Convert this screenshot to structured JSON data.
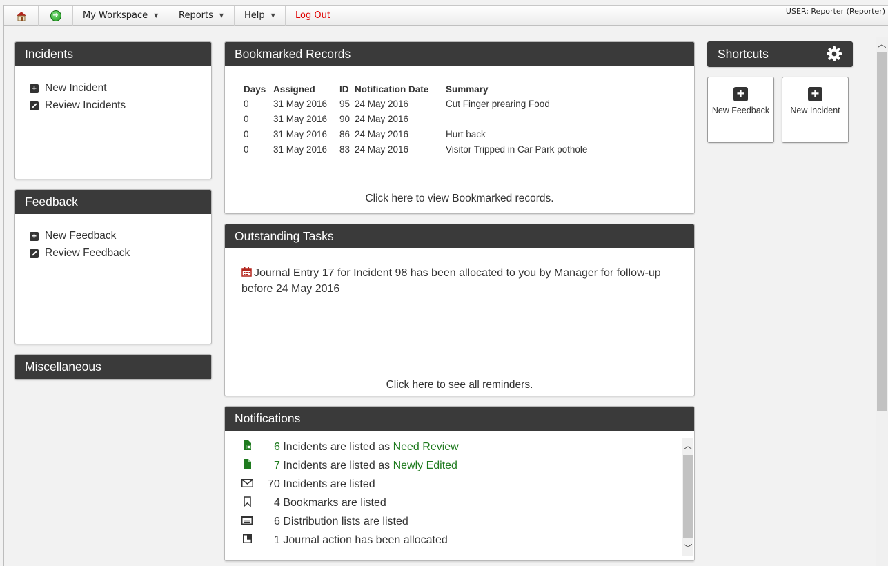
{
  "menubar": {
    "workspace_label": "My Workspace",
    "reports_label": "Reports",
    "help_label": "Help",
    "logout_label": "Log Out",
    "user_info": "USER: Reporter (Reporter)"
  },
  "incidents_panel": {
    "title": "Incidents",
    "items": [
      {
        "label": "New Incident",
        "icon": "plus-square-icon"
      },
      {
        "label": "Review Incidents",
        "icon": "edit-icon"
      }
    ]
  },
  "feedback_panel": {
    "title": "Feedback",
    "items": [
      {
        "label": "New Feedback",
        "icon": "plus-square-icon"
      },
      {
        "label": "Review Feedback",
        "icon": "edit-icon"
      }
    ]
  },
  "misc_panel": {
    "title": "Miscellaneous"
  },
  "bookmarks": {
    "title": "Bookmarked Records",
    "columns": [
      "Days",
      "Assigned",
      "ID",
      "Notification Date",
      "Summary"
    ],
    "rows": [
      [
        "0",
        "31 May 2016",
        "95",
        "24 May 2016",
        "Cut Finger prearing Food"
      ],
      [
        "0",
        "31 May 2016",
        "90",
        "24 May 2016",
        ""
      ],
      [
        "0",
        "31 May 2016",
        "86",
        "24 May 2016",
        "Hurt back"
      ],
      [
        "0",
        "31 May 2016",
        "83",
        "24 May 2016",
        "Visitor Tripped in Car Park pothole"
      ]
    ],
    "footer_link": "Click here to view Bookmarked records."
  },
  "tasks": {
    "title": "Outstanding Tasks",
    "task_text_line1": "Journal Entry 17 for Incident 98 has been allocated to you by Manager for follow-up",
    "task_text_line2": "before 24 May 2016",
    "footer_link": "Click here to see all reminders."
  },
  "notifications": {
    "title": "Notifications",
    "items": [
      {
        "icon": "review-doc-icon",
        "count": "6",
        "text": "Incidents are listed as",
        "highlight": "Need Review",
        "green": true
      },
      {
        "icon": "new-doc-icon",
        "count": "7",
        "text": "Incidents are listed as",
        "highlight": "Newly Edited",
        "green": true
      },
      {
        "icon": "envelope-icon",
        "count": "70",
        "text": "Incidents are listed",
        "highlight": "",
        "green": false
      },
      {
        "icon": "bookmark-icon",
        "count": "4",
        "text": "Bookmarks are listed",
        "highlight": "",
        "green": false
      },
      {
        "icon": "list-icon",
        "count": "6",
        "text": "Distribution lists are listed",
        "highlight": "",
        "green": false
      },
      {
        "icon": "journal-icon",
        "count": "1",
        "text": "Journal action has been allocated",
        "highlight": "",
        "green": false
      }
    ]
  },
  "shortcuts": {
    "title": "Shortcuts",
    "tiles": [
      {
        "label": "New Feedback"
      },
      {
        "label": "New Incident"
      }
    ]
  },
  "colors": {
    "header_bg": "#3a3a3a",
    "link_green": "#1e7a1e",
    "logout_red": "#e00000",
    "page_bg": "#f2f2f2"
  }
}
